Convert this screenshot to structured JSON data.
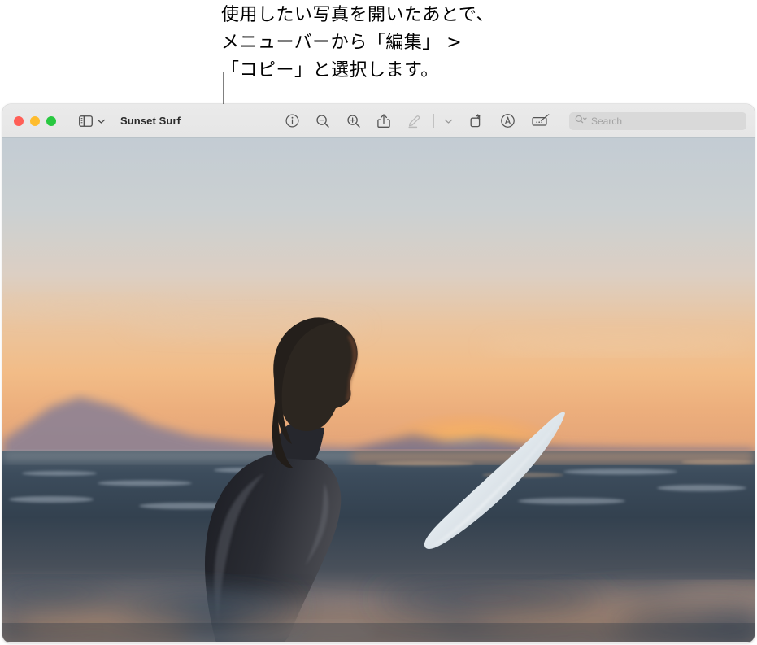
{
  "annotation": {
    "text": "使用したい写真を開いたあとで、\nメニューバーから「編集」 >\n「コピー」と選択します。",
    "leader_line_color": "#808080"
  },
  "window": {
    "title": "Sunset Surf",
    "traffic_lights": [
      {
        "name": "close",
        "label": "閉じる",
        "color": "#ff5f57"
      },
      {
        "name": "minimize",
        "label": "しまう",
        "color": "#febc2e"
      },
      {
        "name": "zoom",
        "label": "フルスクリーン",
        "color": "#28c840"
      }
    ]
  },
  "toolbar": {
    "sidebar_toggle": {
      "icon": "sidebar-icon",
      "label": "サイドバー"
    },
    "sidebar_menu": {
      "icon": "chevron-down-icon"
    },
    "items": [
      {
        "icon": "info-icon",
        "label": "情報",
        "enabled": true
      },
      {
        "icon": "zoom-out-icon",
        "label": "ズームアウト",
        "enabled": true
      },
      {
        "icon": "zoom-in-icon",
        "label": "ズームイン",
        "enabled": true
      },
      {
        "icon": "share-icon",
        "label": "共有",
        "enabled": true
      },
      {
        "icon": "markup-pen-icon",
        "label": "マークアップ",
        "enabled": false
      },
      {
        "icon": "chevron-down-icon",
        "label": "メニュー",
        "enabled": true
      },
      {
        "icon": "rotate-icon",
        "label": "回転",
        "enabled": true
      },
      {
        "icon": "annotate-icon",
        "label": "注釈",
        "enabled": true
      },
      {
        "icon": "signature-icon",
        "label": "署名",
        "enabled": true
      }
    ],
    "search": {
      "icon": "search-icon",
      "dropdown_icon": "chevron-down-icon",
      "value": "",
      "placeholder": "Search"
    }
  },
  "photo": {
    "alt": "Surfer sitting on a surfboard in the ocean at sunset",
    "subject": "surfer-silhouette",
    "colors": {
      "sky_top": "#c3ccd3",
      "sky_mid": "#dfd3c6",
      "sky_warm": "#f0bc8b",
      "sun_glow": "#ffbe5c",
      "mountain": "#8e8193",
      "water_dark": "#2c3b4b",
      "water_highlight": "#e8b089",
      "wetsuit": "#23242a",
      "surfboard": "#e9eef1"
    }
  }
}
